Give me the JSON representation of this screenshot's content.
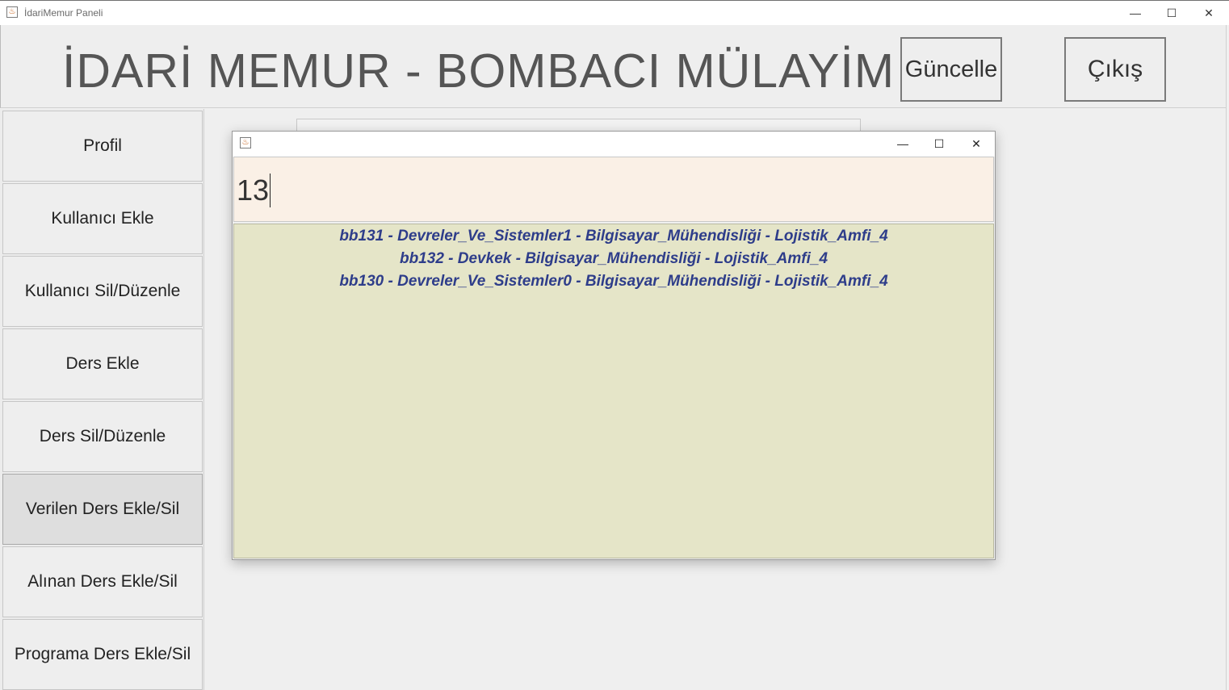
{
  "window": {
    "title": "İdariMemur Paneli",
    "minimize_glyph": "—",
    "maximize_glyph": "☐",
    "close_glyph": "✕"
  },
  "header": {
    "title": "İDARİ MEMUR - BOMBACI MÜLAYİM",
    "update_label": "Güncelle",
    "exit_label": "Çıkış"
  },
  "sidebar": {
    "items": [
      {
        "label": "Profil"
      },
      {
        "label": "Kullanıcı Ekle"
      },
      {
        "label": "Kullanıcı Sil/Düzenle"
      },
      {
        "label": "Ders Ekle"
      },
      {
        "label": "Ders Sil/Düzenle"
      },
      {
        "label": "Verilen Ders Ekle/Sil",
        "selected": true
      },
      {
        "label": "Alınan Ders Ekle/Sil"
      },
      {
        "label": "Programa Ders Ekle/Sil"
      }
    ]
  },
  "popup": {
    "search_value": "13",
    "results": [
      "bb131 - Devreler_Ve_Sistemler1 - Bilgisayar_Mühendisliği - Lojistik_Amfi_4",
      "bb132 - Devkek - Bilgisayar_Mühendisliği - Lojistik_Amfi_4",
      "bb130 - Devreler_Ve_Sistemler0 - Bilgisayar_Mühendisliği - Lojistik_Amfi_4"
    ]
  },
  "colors": {
    "accent_text": "#2e3d8a",
    "search_bg": "#faf0e6",
    "results_bg": "#e5e5c8"
  },
  "icons": {
    "app": "java-cup-icon"
  }
}
